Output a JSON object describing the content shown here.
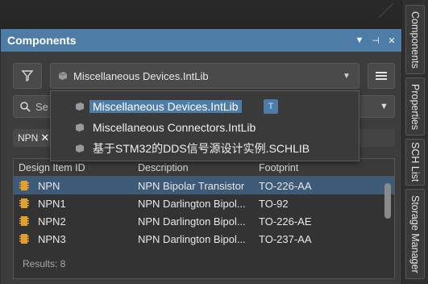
{
  "panel": {
    "title": "Components",
    "title_buttons": [
      "▼",
      "⊣",
      "✕"
    ]
  },
  "library_selector": {
    "selected": "Miscellaneous Devices.IntLib",
    "options": [
      "Miscellaneous Devices.IntLib",
      "Miscellaneous Connectors.IntLib",
      "基于STM32的DDS信号源设计实例.SCHLIB"
    ],
    "badge": "T"
  },
  "search": {
    "placeholder": "Se"
  },
  "filter_chip": {
    "label": "NPN",
    "remove": "✕"
  },
  "table": {
    "headers": [
      "Design Item ID",
      "Description",
      "Footprint"
    ],
    "rows": [
      {
        "id": "NPN",
        "description": "NPN Bipolar Transistor",
        "footprint": "TO-226-AA"
      },
      {
        "id": "NPN1",
        "description": "NPN Darlington Bipol...",
        "footprint": "TO-92"
      },
      {
        "id": "NPN2",
        "description": "NPN Darlington Bipol...",
        "footprint": "TO-226-AE"
      },
      {
        "id": "NPN3",
        "description": "NPN Darlington Bipol...",
        "footprint": "TO-237-AA"
      }
    ],
    "results": "Results: 8"
  },
  "side_tabs": [
    "Components",
    "Properties",
    "SCH List",
    "Storage Manager"
  ],
  "colors": {
    "accent": "#4d7da6",
    "selected_row": "#3d5a78",
    "panel_bg": "#3c3c3c",
    "icon_gold": "#e0a030"
  },
  "icons": {
    "filter": "funnel-icon",
    "library": "library-icon",
    "menu": "hamburger-menu-icon",
    "search": "search-icon",
    "component": "component-chip-icon"
  }
}
